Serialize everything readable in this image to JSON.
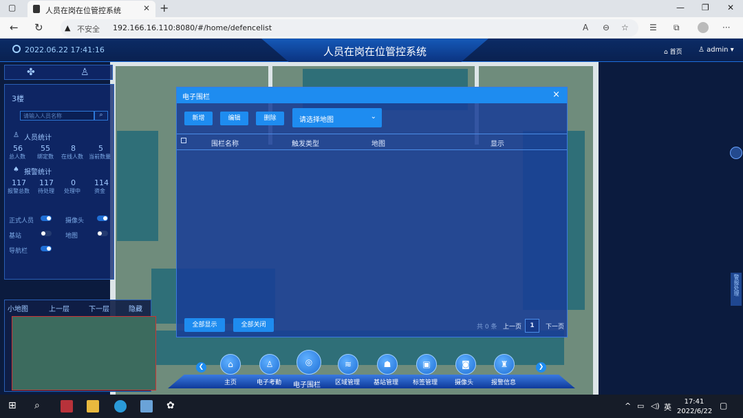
{
  "browser": {
    "tab_title": "人员在岗在位管控系统",
    "security": "不安全",
    "url": "192.166.16.110:8080/#/home/defencelist"
  },
  "app": {
    "datetime": "2022.06.22 17:41:16",
    "title": "人员在岗在位管控系统",
    "home_link": "首页",
    "user": "admin"
  },
  "left_panel": {
    "floor": "3楼",
    "search_placeholder": "请输入人员名称",
    "personnel_title": "人员统计",
    "personnel_stats": [
      {
        "value": "56",
        "label": "总人数"
      },
      {
        "value": "55",
        "label": "绑定数"
      },
      {
        "value": "8",
        "label": "在线人数"
      },
      {
        "value": "5",
        "label": "当前数量"
      }
    ],
    "alarm_title": "报警统计",
    "alarm_stats": [
      {
        "value": "117",
        "label": "报警总数"
      },
      {
        "value": "117",
        "label": "待处理"
      },
      {
        "value": "0",
        "label": "处理中"
      },
      {
        "value": "114",
        "label": "资金"
      }
    ],
    "toggles": [
      {
        "label": "正式人员",
        "on": true
      },
      {
        "label": "摄像头",
        "on": true
      },
      {
        "label": "基站",
        "on": false
      },
      {
        "label": "地图",
        "on": false
      },
      {
        "label": "导航栏",
        "on": true
      }
    ]
  },
  "minimap": {
    "label": "小地图",
    "up": "上一层",
    "down": "下一层",
    "hide": "隐藏"
  },
  "modal": {
    "title": "电子围栏",
    "close": "×",
    "buttons": {
      "add": "新增",
      "edit": "编辑",
      "delete": "删除"
    },
    "select_placeholder": "请选择地图",
    "columns": [
      "围栏名称",
      "触发类型",
      "地图",
      "显示"
    ],
    "show_all": "全部显示",
    "close_all": "全部关闭",
    "pager": {
      "total": "共 0 条",
      "prev": "上一页",
      "page": "1",
      "next": "下一页"
    }
  },
  "dock": {
    "items": [
      {
        "label": "主页",
        "icon": "home-icon"
      },
      {
        "label": "电子考勤",
        "icon": "attendance-icon"
      },
      {
        "label": "电子围栏",
        "icon": "fence-icon"
      },
      {
        "label": "区域管理",
        "icon": "layers-icon"
      },
      {
        "label": "基站管理",
        "icon": "antenna-icon"
      },
      {
        "label": "标签管理",
        "icon": "tag-icon"
      },
      {
        "label": "摄像头",
        "icon": "camera-icon"
      },
      {
        "label": "报警信息",
        "icon": "alarm-icon"
      }
    ]
  },
  "right_edge": "警报处理",
  "taskbar": {
    "ime": "英",
    "time": "17:41",
    "date": "2022/6/22"
  }
}
